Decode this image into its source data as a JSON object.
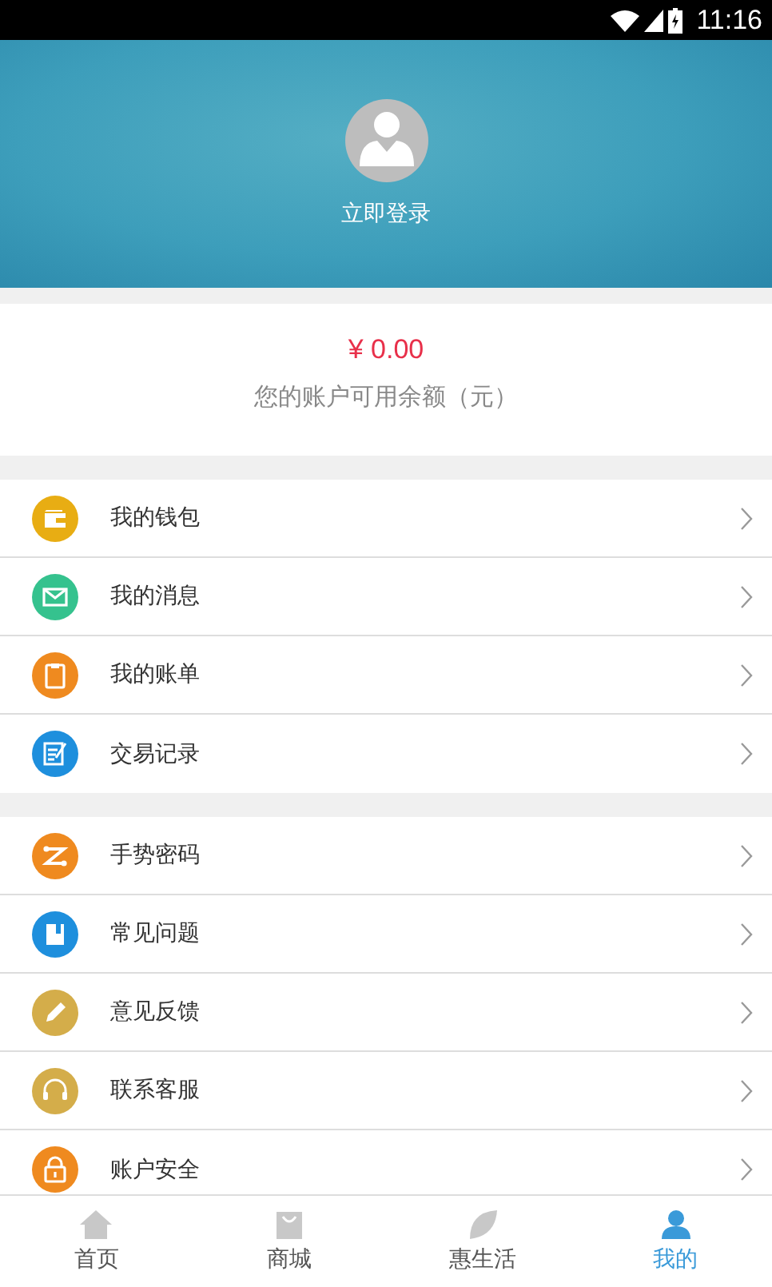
{
  "status_bar": {
    "time": "11:16"
  },
  "header": {
    "login": "立即登录"
  },
  "balance": {
    "amount": "¥ 0.00",
    "caption": "您的账户可用余额（元）"
  },
  "menu_groups": [
    {
      "items": [
        {
          "label": "我的钱包",
          "color": "#e8ad13"
        },
        {
          "label": "我的消息",
          "color": "#35c28e"
        },
        {
          "label": "我的账单",
          "color": "#ef8a1f"
        },
        {
          "label": "交易记录",
          "color": "#1e8fdd"
        }
      ]
    },
    {
      "items": [
        {
          "label": "手势密码",
          "color": "#ef8a1f"
        },
        {
          "label": "常见问题",
          "color": "#1e8fdd"
        },
        {
          "label": "意见反馈",
          "color": "#d4ad4a"
        },
        {
          "label": "联系客服",
          "color": "#d4ad4a"
        },
        {
          "label": "账户安全",
          "color": "#ef8a1f"
        }
      ]
    }
  ],
  "tabs": [
    {
      "label": "首页",
      "selected": false
    },
    {
      "label": "商城",
      "selected": false
    },
    {
      "label": "惠生活",
      "selected": false
    },
    {
      "label": "我的",
      "selected": true
    }
  ]
}
